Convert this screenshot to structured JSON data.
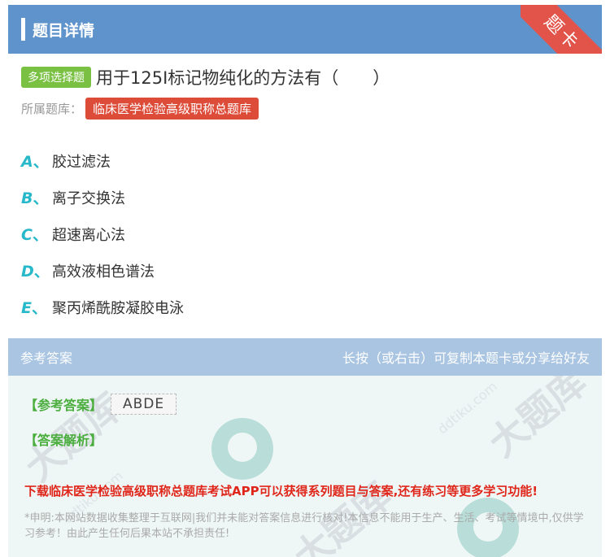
{
  "header": {
    "title": "题目详情",
    "ribbon": "题卡"
  },
  "question": {
    "type_badge": "多项选择题",
    "text": "用于125I标记物纯化的方法有（　　）",
    "library_label": "所属题库：",
    "library_name": "临床医学检验高级职称总题库"
  },
  "options": [
    {
      "letter": "A",
      "text": "胶过滤法"
    },
    {
      "letter": "B",
      "text": "离子交换法"
    },
    {
      "letter": "C",
      "text": "超速离心法"
    },
    {
      "letter": "D",
      "text": "高效液相色谱法"
    },
    {
      "letter": "E",
      "text": "聚丙烯酰胺凝胶电泳"
    }
  ],
  "answer_section": {
    "title": "参考答案",
    "hint": "长按（或右击）可复制本题卡或分享给好友",
    "answer_tag": "【参考答案】",
    "answer_value": "ABDE",
    "analysis_tag": "【答案解析】",
    "promo": "下载临床医学检验高级职称总题库考试APP可以获得系列题目与答案,还有练习等更多学习功能!",
    "disclaimer": "*申明:本网站数据收集整理于互联网|我们并未能对答案信息进行核对!本信息不能用于生产、生活、考试等情境中,仅供学习参考！由此产生任何后果本站不承担责任!"
  },
  "watermark": {
    "brand": "大题库",
    "url": "ddtiku.com"
  },
  "colors": {
    "header_bg": "#5f93cc",
    "accent_teal": "#27b8c9",
    "ribbon_red": "#e2544a",
    "promo_red": "#e0261a"
  }
}
